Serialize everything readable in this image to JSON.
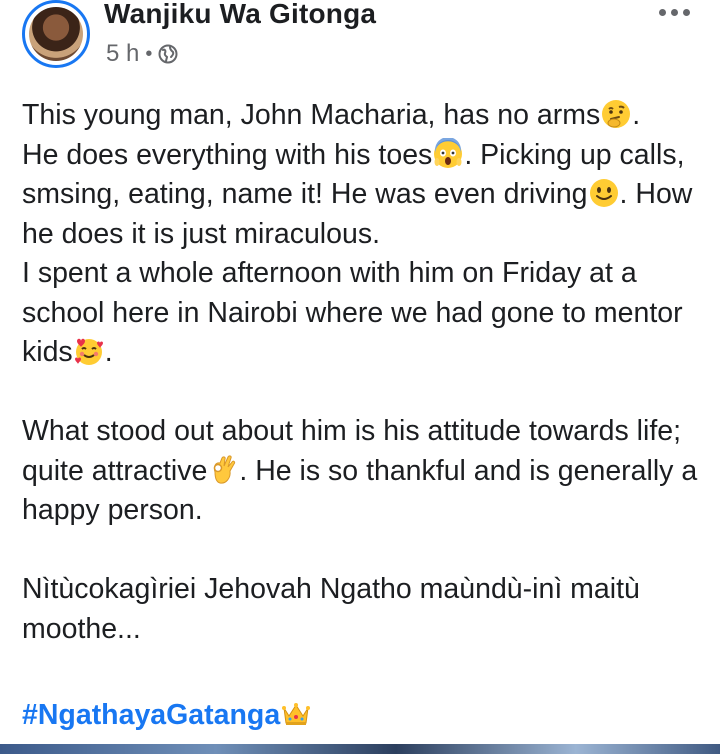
{
  "post": {
    "author": "Wanjiku Wa Gitonga",
    "time": "5 h",
    "separator": "•",
    "audience_icon": "globe-icon",
    "paragraphs": {
      "p1": {
        "s1": "This young man, John Macharia, has no arms",
        "s2": ".\nHe does everything with his toes",
        "s3": ". Picking up calls, smsing, eating, name it! He was even driving",
        "s4": ". How he does it is just miraculous.\nI spent a whole afternoon with him on Friday at a school here in Nairobi where we had gone to mentor kids",
        "s5": "."
      },
      "p2": {
        "s1": "What stood out about him is his attitude towards life; quite attractive",
        "s2": ". He is so thankful and is generally a happy person."
      },
      "p3": "Nìtùcokagìriei Jehovah Ngatho maùndù-inì maitù moothe..."
    },
    "hashtag": "#NgathayaGatanga",
    "emojis": [
      "thinking-face-emoji",
      "screaming-face-emoji",
      "slightly-smiling-face-emoji",
      "smiling-face-with-hearts-emoji",
      "ok-hand-emoji",
      "crown-emoji"
    ]
  },
  "colors": {
    "link": "#1877f2",
    "text": "#1c1e21",
    "meta": "#65676b"
  }
}
